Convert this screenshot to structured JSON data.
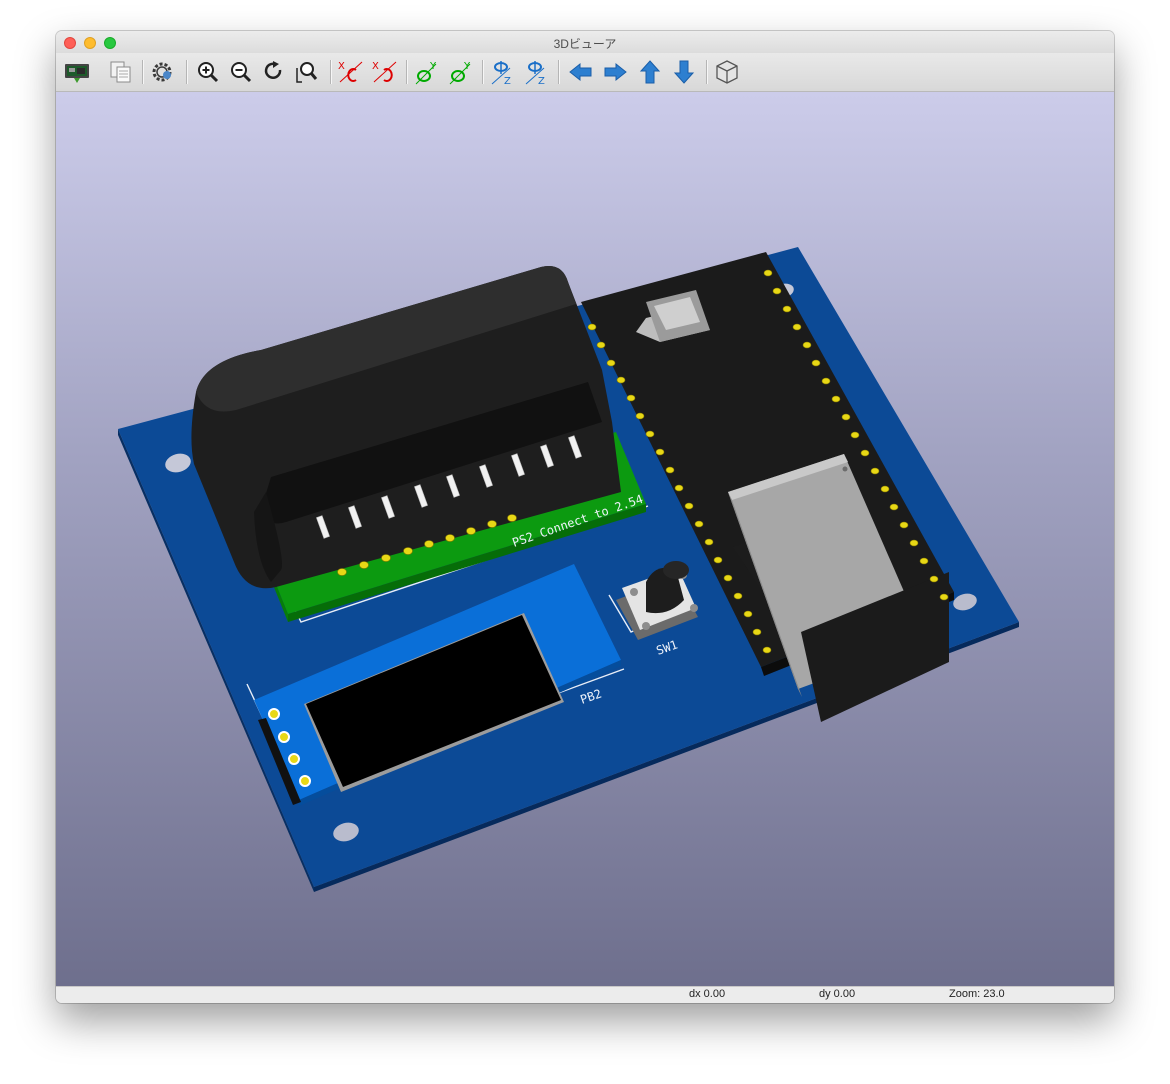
{
  "window": {
    "title": "3Dビューア"
  },
  "toolbar": {
    "buttons": [
      "reload-board-icon",
      "copy-image-icon",
      "preferences-icon",
      "zoom-in-icon",
      "zoom-out-icon",
      "redraw-icon",
      "zoom-fit-icon",
      "rotate-x-cw-icon",
      "rotate-x-ccw-icon",
      "rotate-y-cw-icon",
      "rotate-y-ccw-icon",
      "rotate-z-cw-icon",
      "rotate-z-ccw-icon",
      "move-left-icon",
      "move-right-icon",
      "move-up-icon",
      "move-down-icon",
      "ortho-view-icon"
    ]
  },
  "board": {
    "labels": {
      "connector": "PS2 Connect to 2.54",
      "display": "PB2",
      "switch": "SW1"
    }
  },
  "status": {
    "dx": "dx 0.00",
    "dy": "dy 0.00",
    "zoom": "Zoom: 23.0"
  },
  "colors": {
    "board": "#0c4a96",
    "connector_pcb": "#0c9a10",
    "header_pins": "#e8d816",
    "module": "#1c1c1c",
    "display_frame": "#0a6fd8",
    "shield": "#a7a7a7"
  }
}
